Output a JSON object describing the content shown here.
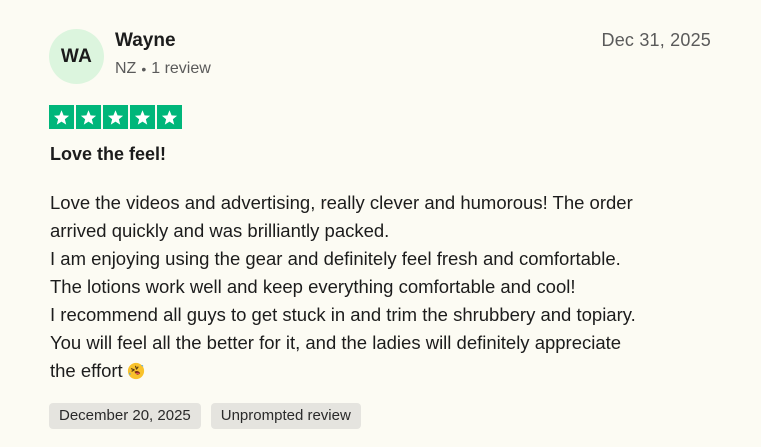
{
  "reviewer": {
    "initials": "WA",
    "name": "Wayne",
    "country": "NZ",
    "review_count": "1 review"
  },
  "review": {
    "date": "Dec 31, 2025",
    "rating": 5,
    "star_color": "#00b67a",
    "title": "Love the feel!",
    "body_lines": [
      "Love the videos and advertising, really clever and humorous! The order",
      "arrived quickly and was brilliantly packed.",
      "I am enjoying using the gear and definitely feel fresh and comfortable.",
      "The lotions work well and keep everything comfortable and cool!",
      "I recommend all guys to get stuck in and trim the shrubbery and topiary.",
      "You will feel all the better for it, and the ladies will definitely appreciate",
      "the effort"
    ],
    "emoji": "rolling-on-floor-laughing-icon"
  },
  "tags": {
    "experience_date": "December 20, 2025",
    "source": "Unprompted review"
  },
  "colors": {
    "background": "#fcfbf3",
    "avatar_bg": "#dcf5de",
    "tag_bg": "#e5e4df"
  }
}
